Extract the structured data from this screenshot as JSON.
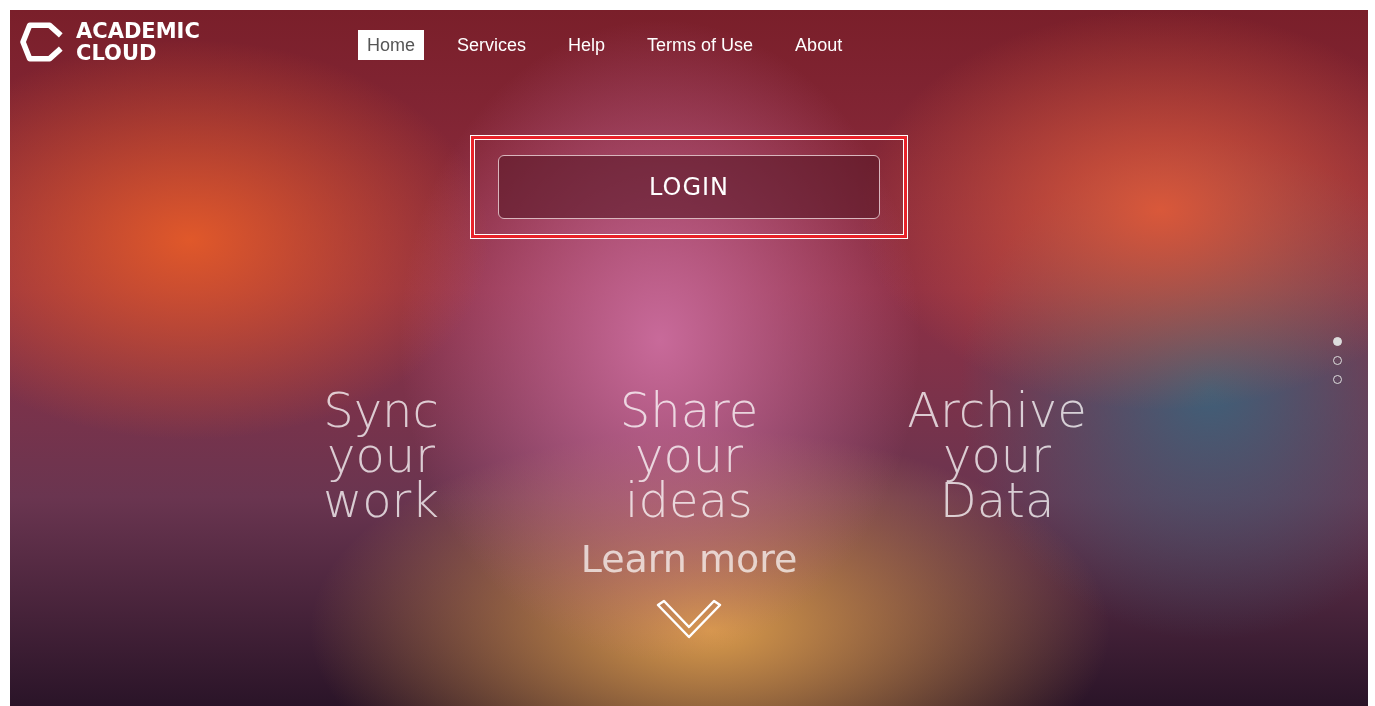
{
  "logo": {
    "line_1": "ACADEMIC",
    "line_2": "CLOUD"
  },
  "nav": [
    {
      "label": "Home",
      "selected": true
    },
    {
      "label": "Services",
      "selected": false
    },
    {
      "label": "Help",
      "selected": false
    },
    {
      "label": "Terms of Use",
      "selected": false
    },
    {
      "label": "About",
      "selected": false
    }
  ],
  "login_button": {
    "label": "LOGIN",
    "highlighted": true
  },
  "features": [
    {
      "lines": [
        "Sync",
        "your",
        "work"
      ]
    },
    {
      "lines": [
        "Share",
        "your",
        "ideas"
      ]
    },
    {
      "lines": [
        "Archive",
        "your",
        "Data"
      ]
    }
  ],
  "learn_more": "Learn more",
  "slide_dots": [
    {
      "selected": true
    },
    {
      "selected": false
    },
    {
      "selected": false
    }
  ]
}
